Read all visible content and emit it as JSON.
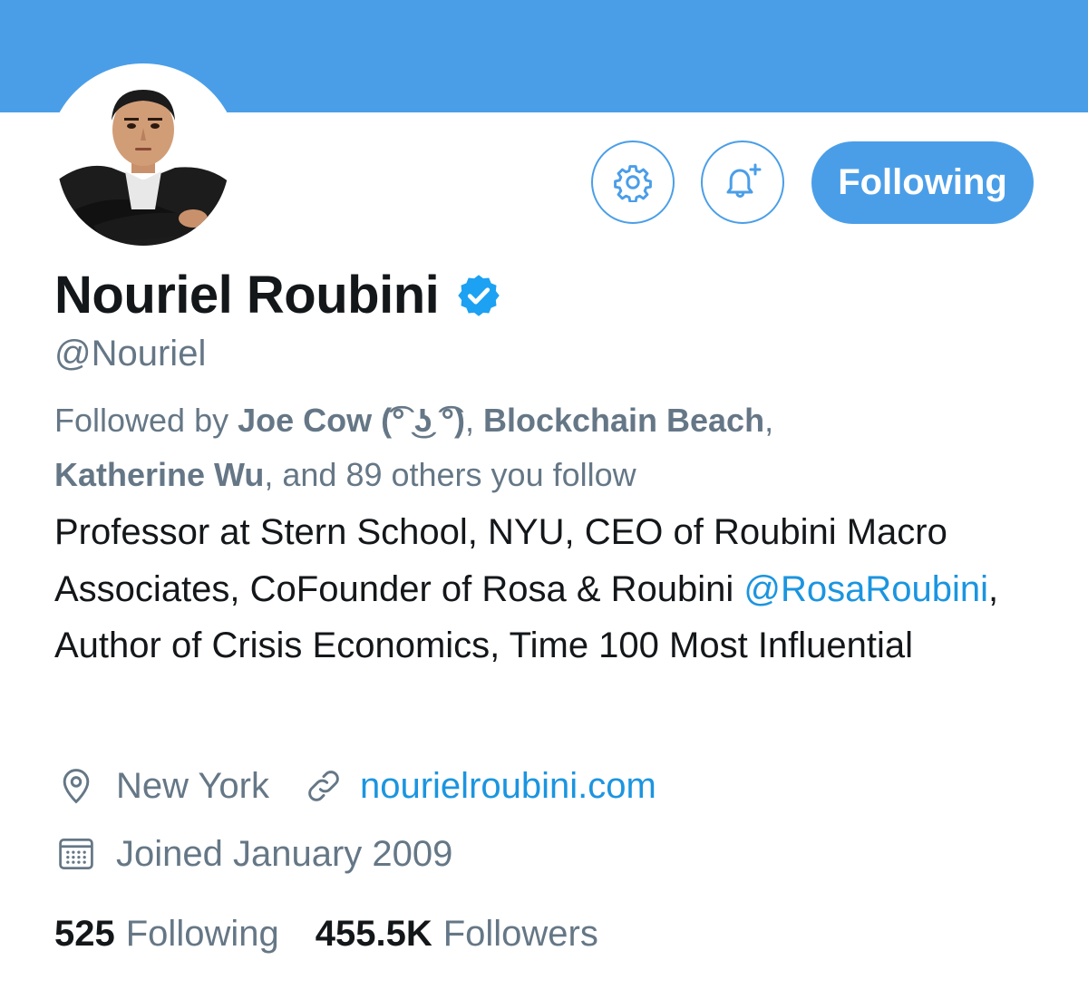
{
  "colors": {
    "banner": "#4a9ee8",
    "accent": "#4a9ee8",
    "link": "#1b95e0",
    "secondary_text": "#657786",
    "primary_text": "#14171a"
  },
  "header": {
    "settings_icon": "gear-icon",
    "notify_icon": "bell-plus-icon",
    "follow_button_label": "Following"
  },
  "profile": {
    "name": "Nouriel Roubini",
    "verified": true,
    "handle": "@Nouriel",
    "followed_by": {
      "prefix": "Followed by ",
      "users": [
        "Joe Cow (͡° ͜ʖ ͡°)",
        "Blockchain Beach",
        "Katherine Wu"
      ],
      "sep1": ", ",
      "sep2": ",",
      "suffix": ", and 89 others you follow"
    },
    "bio": {
      "part1": "Professor at Stern School, NYU, CEO of Roubini Macro Associates, CoFounder of Rosa & Roubini ",
      "mention": "@RosaRoubini",
      "part2": ", Author of Crisis Economics, Time 100 Most Influential"
    },
    "location": "New York",
    "website": "nourielroubini.com",
    "joined": "Joined January 2009"
  },
  "stats": {
    "following_count": "525",
    "following_label": "Following",
    "followers_count": "455.5K",
    "followers_label": "Followers"
  }
}
